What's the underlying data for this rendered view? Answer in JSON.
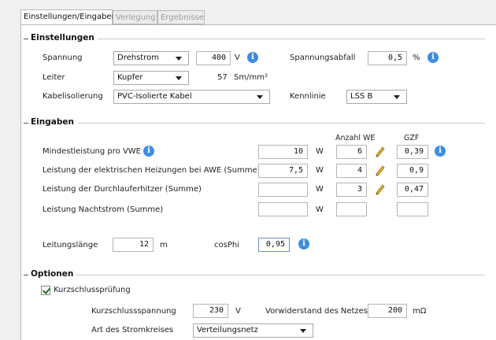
{
  "tabs": [
    {
      "label": "Einstellungen/Eingaben",
      "active": true
    },
    {
      "label": "Verlegung",
      "active": false
    },
    {
      "label": "Ergebnisse",
      "active": false
    }
  ],
  "settings": {
    "title": "Einstellungen",
    "spannung_label": "Spannung",
    "spannung_select": "Drehstrom",
    "spannung_value": "400",
    "spannung_unit": "V",
    "spannungsabfall_label": "Spannungsabfall",
    "spannungsabfall_value": "0,5",
    "spannungsabfall_unit": "%",
    "leiter_label": "Leiter",
    "leiter_select": "Kupfer",
    "leiter_value": "57",
    "leiter_unit": "Sm/mm²",
    "kabel_label": "Kabelisolierung",
    "kabel_select": "PVC-Isolierte Kabel",
    "kennlinie_label": "Kennlinie",
    "kennlinie_select": "LSS B"
  },
  "inputs": {
    "title": "Eingaben",
    "col_anzahl": "Anzahl WE",
    "col_gzf": "GZF",
    "rows": [
      {
        "label": "Mindestleistung pro VWE",
        "value": "10",
        "unit": "W",
        "anzahl": "6",
        "gzf": "0,39"
      },
      {
        "label": "Leistung der elektrischen Heizungen bei AWE (Summe)",
        "value": "7,5",
        "unit": "W",
        "anzahl": "4",
        "gzf": "0,9"
      },
      {
        "label": "Leistung der Durchlauferhitzer (Summe)",
        "value": "",
        "unit": "W",
        "anzahl": "3",
        "gzf": "0,47"
      },
      {
        "label": "Leistung Nachtstrom (Summe)",
        "value": "",
        "unit": "W",
        "anzahl": "",
        "gzf": ""
      }
    ],
    "laenge_label": "Leitungslänge",
    "laenge_value": "12",
    "laenge_unit": "m",
    "cosphi_label": "cosPhi",
    "cosphi_value": "0,95"
  },
  "options": {
    "title": "Optionen",
    "kurzschluss_label": "Kurzschlussprüfung",
    "kurzschluss_checked": true,
    "ks_spannung_label": "Kurzschlussspannung",
    "ks_spannung_value": "230",
    "ks_spannung_unit": "V",
    "vorwiderstand_label": "Vorwiderstand des Netzes",
    "vorwiderstand_value": "200",
    "vorwiderstand_unit": "mΩ",
    "stromkreis_label": "Art des Stromkreises",
    "stromkreis_select": "Verteilungsnetz"
  },
  "icons": {
    "info": "i"
  },
  "colors": {
    "info_blue": "#3c8ee3",
    "pencil": "#d9a72a"
  }
}
